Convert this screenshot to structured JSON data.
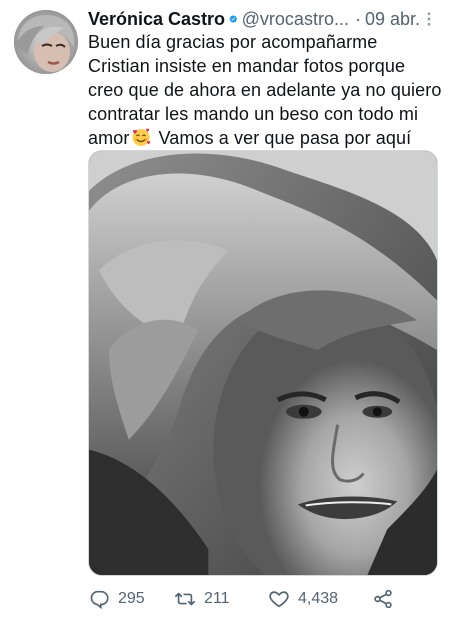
{
  "author": {
    "display_name": "Verónica Castro",
    "handle": "@vrocastro...",
    "separator": "·",
    "date": "09 abr."
  },
  "tweet": {
    "text_part1": "Buen día gracias por acompañarme Cristian insiste en mandar fotos porque creo que de ahora en adelante ya no quiero contratar les mando un beso con todo mi amor",
    "emoji": "smiling-face-with-hearts",
    "text_part2": " Vamos a ver que pasa por aquí"
  },
  "actions": {
    "replies": "295",
    "retweets": "211",
    "likes": "4,438"
  },
  "icons": {
    "verified": "verified-badge-icon",
    "more": "more-options-icon",
    "reply": "reply-icon",
    "retweet": "retweet-icon",
    "like": "heart-icon",
    "share": "share-icon"
  },
  "colors": {
    "verified": "#1d9bf0",
    "secondary_text": "#536471",
    "primary_text": "#0f1419"
  }
}
